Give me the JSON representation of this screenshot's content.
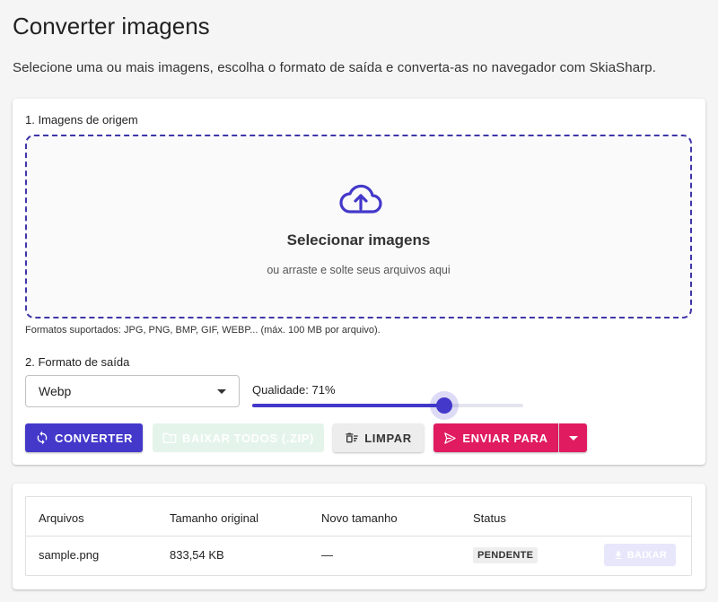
{
  "page": {
    "title": "Converter imagens",
    "subtitle": "Selecione uma ou mais imagens, escolha o formato de saída e converta-as no navegador com SkiaSharp."
  },
  "source": {
    "section_label": "1. Imagens de origem",
    "dropzone_title": "Selecionar imagens",
    "dropzone_hint": "ou arraste e solte seus arquivos aqui",
    "dropzone_icon": "cloud-upload-icon",
    "formats_note": "Formatos suportados: JPG, PNG, BMP, GIF, WEBP... (máx. 100 MB por arquivo)."
  },
  "output": {
    "section_label": "2. Formato de saída",
    "format_value": "Webp",
    "quality_label": "Qualidade: 71%",
    "quality_value": 71
  },
  "actions": {
    "convert": "CONVERTER",
    "download_zip": "BAIXAR TODOS (.ZIP)",
    "clear": "LIMPAR",
    "send_to": "ENVIAR PARA"
  },
  "table": {
    "headers": [
      "Arquivos",
      "Tamanho original",
      "Novo tamanho",
      "Status"
    ],
    "rows": [
      {
        "file": "sample.png",
        "original_size": "833,54 KB",
        "new_size": "—",
        "status": "PENDENTE",
        "download": "BAIXAR"
      }
    ]
  },
  "colors": {
    "primary": "#4338ca",
    "accent": "#e01b60",
    "success_disabled": "#e4f4ea",
    "primary_disabled": "#e7e6fb"
  }
}
